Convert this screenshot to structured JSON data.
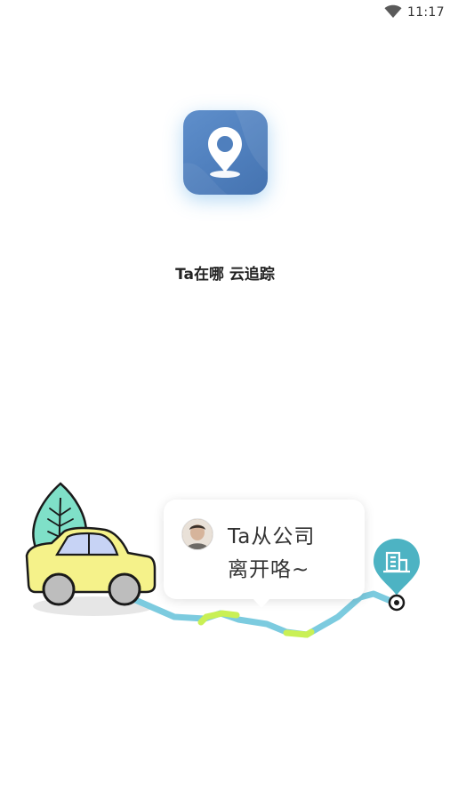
{
  "status_bar": {
    "time": "11:17",
    "wifi_icon": "wifi-icon"
  },
  "app": {
    "icon": "location-pin-icon",
    "name": "Ta在哪 云追踪"
  },
  "illustration": {
    "message_line1": "Ta从公司",
    "message_line2": "离开咯~",
    "destination_icon": "building-icon",
    "vehicle_icon": "car-icon",
    "tree_icon": "leaf-tree-icon"
  },
  "colors": {
    "app_icon_bg": "#4f7fbd",
    "route": "#7ccbdf",
    "route_highlight": "#c9f055",
    "destination_pin": "#4db3c3",
    "car_body": "#f5f28a",
    "tree": "#7fe0c8"
  }
}
